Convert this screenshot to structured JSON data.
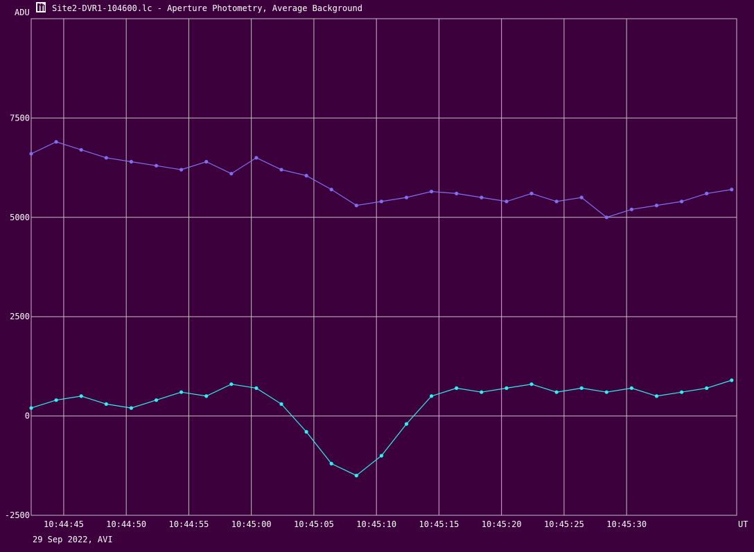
{
  "window": {
    "title": "Site2-DVR1-104600.lc - Aperture Photometry, Average Background",
    "icon": "lightcurve-app-icon"
  },
  "footer": {
    "caption": "29 Sep 2022, AVI"
  },
  "colors": {
    "background": "#3c003c",
    "grid": "#c8bcc8",
    "text": "#ffffff",
    "series_target": "#8070f0",
    "series_background": "#30f0f0"
  },
  "chart_data": {
    "type": "line",
    "title": "Site2-DVR1-104600.lc - Aperture Photometry, Average Background",
    "xlabel": "UT",
    "ylabel": "ADU",
    "x_unit": "seconds after 10:44:40 UT",
    "xlim": [
      2.4,
      58.8
    ],
    "ylim": [
      -2500,
      10000
    ],
    "x_ticks": [
      5,
      10,
      15,
      20,
      25,
      30,
      35,
      40,
      45,
      50
    ],
    "x_tick_labels": [
      "10:44:45",
      "10:44:50",
      "10:44:55",
      "10:45:00",
      "10:45:05",
      "10:45:10",
      "10:45:15",
      "10:45:20",
      "10:45:25",
      "10:45:30"
    ],
    "y_ticks": [
      -2500,
      0,
      2500,
      5000,
      7500
    ],
    "y_tick_labels": [
      "-2500",
      "0",
      "2500",
      "5000",
      "7500"
    ],
    "grid": true,
    "legend": "none",
    "marker": "circle",
    "series": [
      {
        "key": "target",
        "color": "#8070f0",
        "x": [
          2.4,
          4.4,
          6.4,
          8.4,
          10.4,
          12.4,
          14.4,
          16.4,
          18.4,
          20.4,
          22.4,
          24.4,
          26.4,
          28.4,
          30.4,
          32.4,
          34.4,
          36.4,
          38.4,
          40.4,
          42.4,
          44.4,
          46.4,
          48.4,
          50.4,
          52.4,
          54.4,
          56.4,
          58.4
        ],
        "values": [
          6600,
          6900,
          6700,
          6500,
          6400,
          6300,
          6200,
          6400,
          6100,
          6500,
          6200,
          6050,
          5700,
          5300,
          5400,
          5500,
          5650,
          5600,
          5500,
          5400,
          5600,
          5400,
          5500,
          5000,
          5200,
          5300,
          5400,
          5600,
          5700
        ]
      },
      {
        "key": "background",
        "color": "#30f0f0",
        "x": [
          2.4,
          4.4,
          6.4,
          8.4,
          10.4,
          12.4,
          14.4,
          16.4,
          18.4,
          20.4,
          22.4,
          24.4,
          26.4,
          28.4,
          30.4,
          32.4,
          34.4,
          36.4,
          38.4,
          40.4,
          42.4,
          44.4,
          46.4,
          48.4,
          50.4,
          52.4,
          54.4,
          56.4,
          58.4
        ],
        "values": [
          200,
          400,
          500,
          300,
          200,
          400,
          600,
          500,
          800,
          700,
          300,
          -400,
          -1200,
          -1500,
          -1000,
          -200,
          500,
          700,
          600,
          700,
          800,
          600,
          700,
          600,
          700,
          500,
          600,
          700,
          900
        ]
      }
    ]
  }
}
